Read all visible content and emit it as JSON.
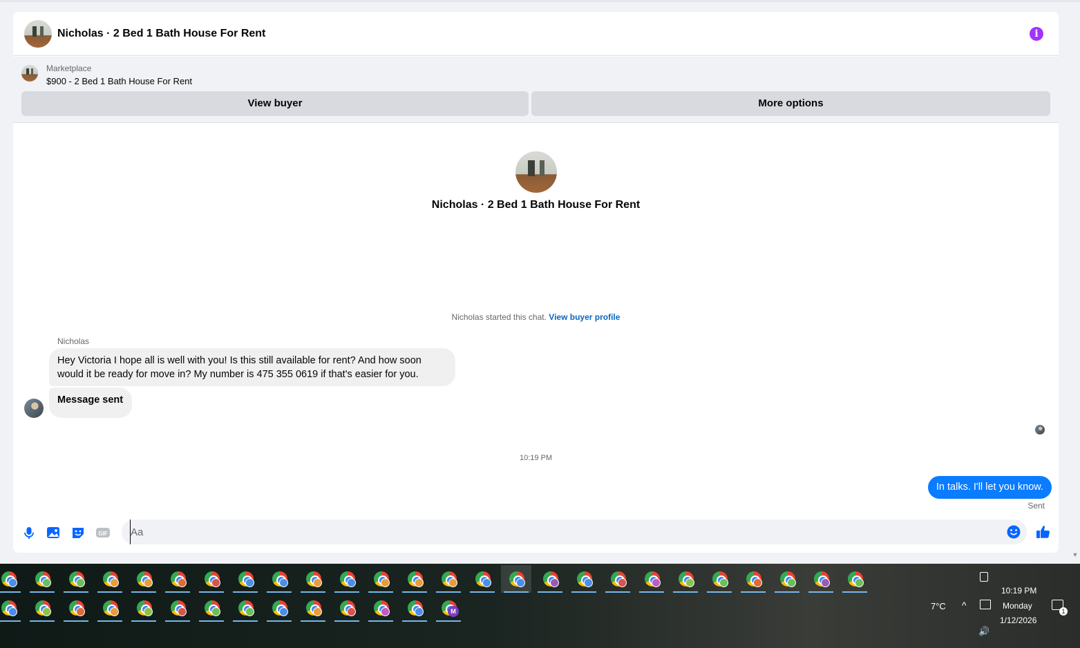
{
  "chat": {
    "header_title": "Nicholas · 2 Bed 1 Bath House For Rent",
    "marketplace_label": "Marketplace",
    "listing": "$900 - 2 Bed 1 Bath House For Rent",
    "view_buyer_label": "View buyer",
    "more_options_label": "More options",
    "intro_name": "Nicholas · 2 Bed 1 Bath House For Rent",
    "started_text": "Nicholas started this chat.",
    "view_profile_link": "View buyer profile",
    "sender_name": "Nicholas",
    "messages_in": [
      "Hey Victoria I hope all is well with you! Is this still available for rent?  And how soon would it be ready for move in? My number is 475 355 0619 if that's easier for you.",
      "Message sent"
    ],
    "timestamp": "10:19 PM",
    "message_out": "In talks. I'll let you know.",
    "status": "Sent"
  },
  "composer": {
    "placeholder": "Aa",
    "gif_label": "GIF"
  },
  "taskbar": {
    "temperature": "7°C",
    "time": "10:19 PM",
    "day": "Monday",
    "date": "1/12/2026",
    "notification_count": "1",
    "app_icons": "chrome-icon",
    "last_profile_letter": "M"
  },
  "colors": {
    "accent": "#0866ff",
    "out_bubble": "#0a7cff",
    "info": "#a033ff",
    "link": "#0a66c2"
  }
}
